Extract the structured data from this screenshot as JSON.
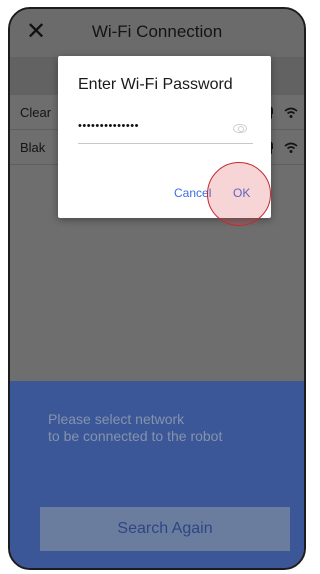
{
  "header": {
    "title": "Wi-Fi Connection",
    "close_icon": "close-icon"
  },
  "networks": [
    {
      "name": "Clear",
      "secured": true,
      "signal_icon": "wifi-icon"
    },
    {
      "name": "Blak",
      "secured": true,
      "signal_icon": "wifi-icon"
    }
  ],
  "dialog": {
    "title": "Enter Wi-Fi Password",
    "password_mask": "••••••••••••••",
    "visibility_icon": "eye-icon",
    "cancel_label": "Cancel",
    "ok_label": "OK"
  },
  "panel": {
    "prompt_line1": "Please select network",
    "prompt_line2": "to be connected to the robot",
    "search_label": "Search Again"
  },
  "colors": {
    "accent": "#3b6fe0",
    "panel_bg": "#3b5797",
    "tap_marker": "#c8282e"
  }
}
